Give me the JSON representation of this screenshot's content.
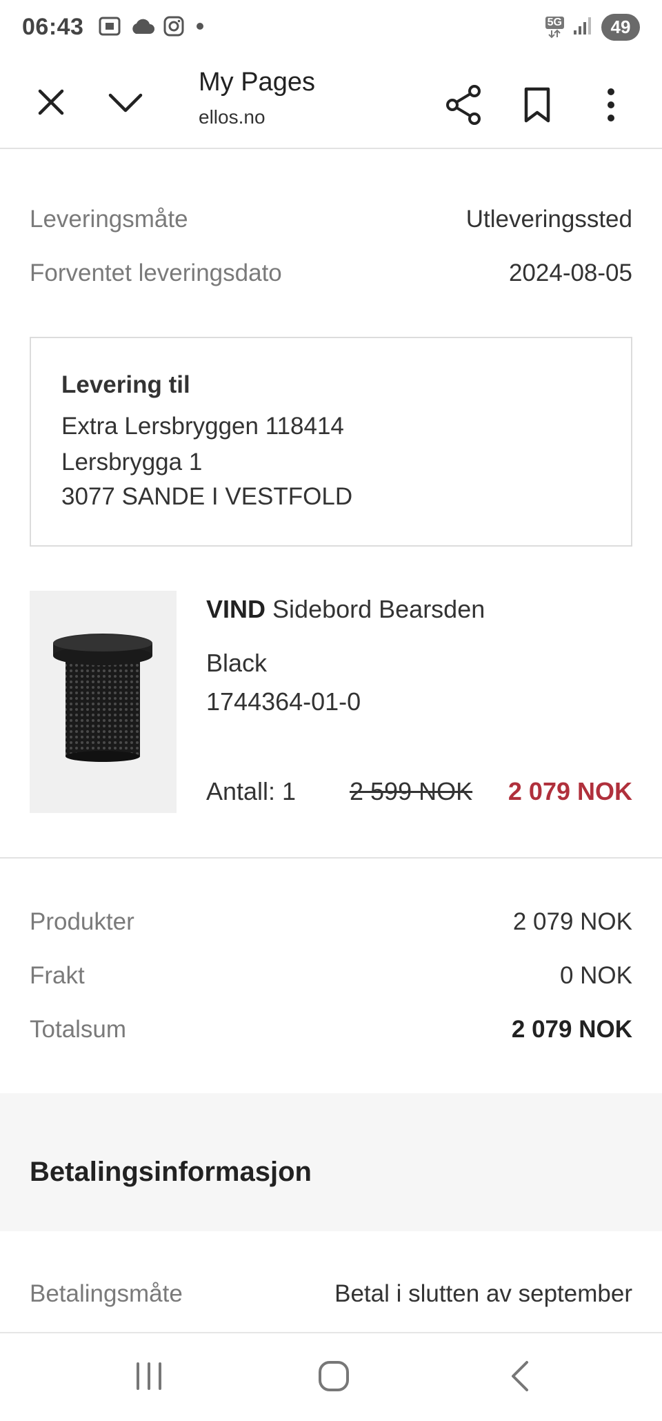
{
  "status_bar": {
    "time": "06:43",
    "network": "5G",
    "battery": "49",
    "icons": [
      "screenshot-icon",
      "cloud-icon",
      "instagram-icon",
      "dot-icon",
      "network-5g-icon",
      "signal-icon",
      "battery-icon"
    ]
  },
  "browser": {
    "title": "My Pages",
    "domain": "ellos.no",
    "icons": [
      "close-icon",
      "chevron-down-icon",
      "share-icon",
      "bookmark-icon",
      "more-vert-icon"
    ]
  },
  "delivery": {
    "method_label": "Leveringsmåte",
    "method_value": "Utleveringssted",
    "date_label": "Forventet leveringsdato",
    "date_value": "2024-08-05"
  },
  "address": {
    "heading": "Levering til",
    "line1": "Extra Lersbryggen 118414",
    "line2": "Lersbrygga 1",
    "line3": "3077 SANDE I VESTFOLD"
  },
  "product": {
    "brand": "VIND",
    "name": "Sidebord Bearsden",
    "color": "Black",
    "sku": "1744364-01-0",
    "quantity": "Antall: 1",
    "old_price": "2 599 NOK",
    "new_price": "2 079 NOK",
    "sale_color": "#b0303c"
  },
  "summary": {
    "products_label": "Produkter",
    "products_value": "2 079 NOK",
    "shipping_label": "Frakt",
    "shipping_value": "0 NOK",
    "total_label": "Totalsum",
    "total_value": "2 079 NOK"
  },
  "payment": {
    "heading": "Betalingsinformasjon",
    "method_label": "Betalingsmåte",
    "method_value": "Betal i slutten av september"
  },
  "navbar": {
    "icons": [
      "recent-apps-icon",
      "home-icon",
      "back-icon"
    ]
  }
}
